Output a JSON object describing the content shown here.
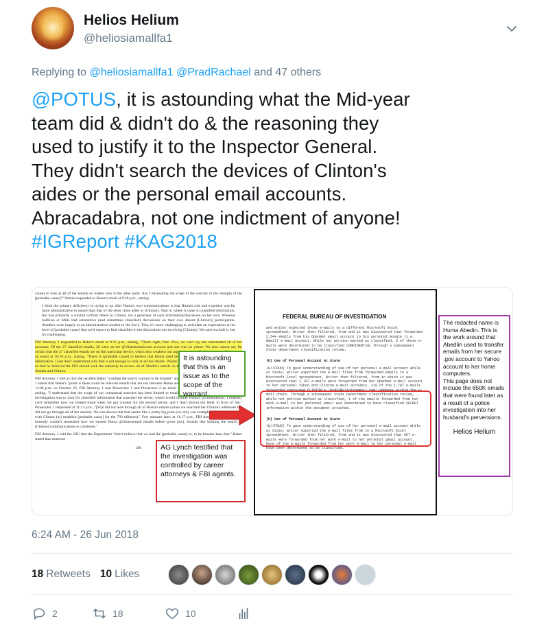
{
  "author": {
    "name": "Helios Helium",
    "handle": "@heliosiamallfa1",
    "avatar_icon": "flame-avatar"
  },
  "reply_context": {
    "prefix": "Replying to",
    "mention_1": "@heliosiamallfa1",
    "mention_2": "@PradRachael",
    "and_others": "and 47 others"
  },
  "tweet": {
    "mention": "@POTUS",
    "line_1_rest": ", it is astounding what the Mid-year",
    "line_2": "team did & didn't do & the reasoning they",
    "line_3": "used to justify it to the Inspector General.",
    "line_4": "They didn't search the devices of Clinton's",
    "line_5": "aides or the personal email accounts.",
    "line_6": "Abracadabra, not one indictment of anyone!",
    "hashtag_1": "#IGReport",
    "hashtag_2": "#KAG2018"
  },
  "media": {
    "left_doc": {
      "para_1": "cause] to look at all of her emails no matter who is the other party. Am I misreading the scope of the warrant or the strength of the [probable cause]?\" Strzok responded to Baker's email at 9:26 p.m., stating:",
      "para_2": "I think the primary deficiency in trying to go after Huma's own communications is that Huma's role and expertise was far more administrative in nature than that of the other close aides to [Clinton]. That is, where it came to classified information, she was primarily a conduit to/from others to Clinton, not a generator of such information/discussion on her own. Whereas Sullivan or Mills had substantive (and sometimes classified) discussions on their own absent [Clinton's] participation, Abedin's were largely as an administrative conduit to the Sec'y. This, it's more challenging to articulate an expectation at the level of [probable cause] that we'd expect to find classified in her discussions not involving [Clinton]. We can't exclude it, but it's challenging.",
      "para_3_hl": "FBI Attorney 1 responded to Baker's email at 9:35 p.m., stating, \"That's right, Pete. Plus, we can't say she transmitted all of her accounts. Of the 27 classified emails, 26 were on her @clintonemail.com account and one was on yahoo. We also cannot say for certain that the 27 classified emails are on this particular device, which also weakens our argument generally.\" In response, Baker sent an email at 10:18 p.m., stating, \"There is [probable cause] to believe that Huma used her email accounts to mishandle classified information. I just don't understand why that is not enough to look at all her emails. Would you please discuss with Pete.\" Baker told us that he believed the FBI should seek the authority to review all of Abedin's emails on the laptop, instead of just emails between Abedin and Clinton.",
      "para_4": "FBI Attorney 1 told us that she recalled Baker \"wanting the search warrant to be broader\" and in an email on October 29 FBI Attorney 1 stated that Baker's \"point is there could be relevant emails that are not between Huma and HRC--particularly regarding intent.\" At 11:06 p.m. on October 29, FBI Attorney 1 sent Prosecutor 1 and Prosecutor 2 an email informing them of Baker's concerns and adding, \"I understand that the scope of our consensual searches has been limited to emails with [Clinton], but the purpose of our investigation was to look for classified information that transited the server, which would include Huma's @clintonemail. I honestly can't remember how we treated those when we got consent for the second server, and I don't [have] the letter in front of me.\" Prosecutor 1 responded at 11:13 p.m., \"[W]e did not look through all of Huma's emails (when we searched her Clinton's addresses but did not go through all of her emails). We can discuss but that seems like a pretty big push (we only use examples of communications with Clinton (to] establish [probable cause] for the 793 offenses).\" Few minutes later, at 11:17 p.m., FBI Attorney 1 responded, \"I honestly couldn't remember how we treated Huma @clintonemail emails before given [sic]. Sounds like limiting the search to [Clinton] communications is consistent.\"",
      "para_5": "FBI Attorney 1 told the OIG that the Department \"didn't believe that we had the [probable cause] to, to be broader than that.\" Baker stated that someone",
      "page_num": "380",
      "green_note": "It is astounding that this is an issue as to the scope of the warrant.",
      "red_note": "AG Lynch testified that the investigation was controlled by career attorneys & FBI agents."
    },
    "right_doc": {
      "agency": "FEDERAL BUREAU OF INVESTIGATION",
      "text_1": "and writer expected those e-mails to a different Microsoft Excel spreadsheet. Writer then filtered, from and it was discovered that forwarded 2,544 emails from his OpenNet email account to his personal Google (i.e. Gmail) e-mail account. While not portion marked as classified, 3 of those e-mails were determined to be classified CONFIDENTIAL through a subsequent State department classification review.",
      "section_1": "(U) Use of Personal Account At State",
      "text_2": "(U//FOUO) To gain understanding of use of her personal e-mail account while at State, writer exported the e-mail files from forwarded Emails to a Microsoft Excel spreadsheet. Writer then filtered, from in which it was discovered that 1,787 e-mails were forwarded from her OpenNet e-mail account to her personal Yahoo and Clinton e-mail accounts. 118 of the 1,787 e-mails forwarded contained CLINTON's 'hrd22@clintonemail.com' address within the e-mail chain. Through a subsequent State Department classification review, while not portion marked as classified, 1 of the emails forwarded from her work e-mail to her personal email was determined to have classified SECRET information within the document attached.",
      "section_2": "(U) Use of Personal Account At State",
      "text_3": "(U//FOUO) To gain understanding of use of her personal e-mail account while at State, writer exported the e-mail files from to a Microsoft Excel spreadsheet. Writer then filtered, from and it was discovered that 657 e-mails were forwarded from her work e-mail to her personal gmail account. None of the e-mails forwarded from her work e-mail to her personal e-mail have been determined to be classified.",
      "purple_note_1": "The redacted name is Huma Abedin. This is the work around that Abedlin used to transfer emails from her secure .gov account to Yahoo account to her home computers.",
      "purple_note_2": "This page does not include the 650K emails that were found later as a result of a police investigation into her husband's perversions.",
      "signature": "Helios Helium"
    }
  },
  "timestamp": "6:24 AM - 26 Jun 2018",
  "stats": {
    "retweets_count": "18",
    "retweets_label": "Retweets",
    "likes_count": "10",
    "likes_label": "Likes"
  },
  "actions": {
    "reply_count": "2",
    "retweet_count": "18",
    "like_count": "10"
  },
  "colors": {
    "accent": "#1da1f2",
    "muted": "#657786"
  }
}
